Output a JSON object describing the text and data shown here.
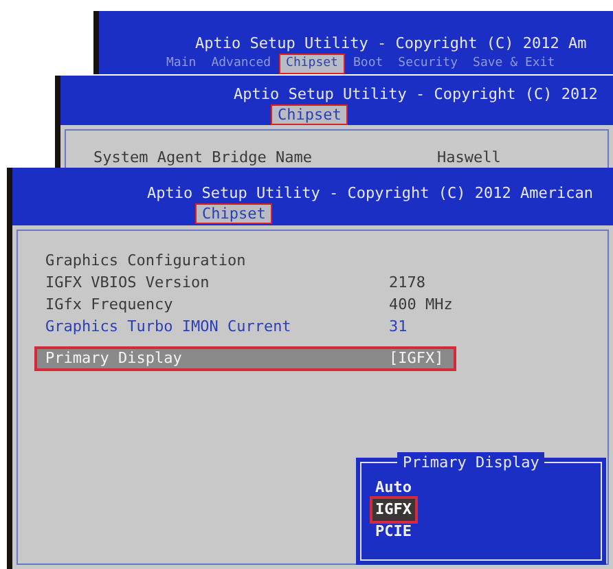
{
  "screens": [
    {
      "title": "Aptio Setup Utility - Copyright (C) 2012 Am",
      "tabs": [
        {
          "label": "Main",
          "selected": false
        },
        {
          "label": "Advanced",
          "selected": false
        },
        {
          "label": "Chipset",
          "selected": true
        },
        {
          "label": "Boot",
          "selected": false
        },
        {
          "label": "Security",
          "selected": false
        },
        {
          "label": "Save & Exit",
          "selected": false
        }
      ]
    },
    {
      "title": "Aptio Setup Utility - Copyright (C) 2012",
      "tabs": [
        {
          "label": "Chipset",
          "selected": true
        }
      ],
      "items": [
        {
          "label": "System Agent Bridge Name",
          "value": "Haswell",
          "kind": "info",
          "selected": false
        }
      ]
    },
    {
      "title": "Aptio Setup Utility - Copyright (C) 2012 American",
      "tabs": [
        {
          "label": "Chipset",
          "selected": true
        }
      ],
      "items": [
        {
          "label": "Graphics Configuration",
          "kind": "heading",
          "selected": false
        },
        {
          "label": "IGFX VBIOS Version",
          "value": "2178",
          "kind": "info",
          "selected": false
        },
        {
          "label": "IGfx Frequency",
          "value": "400 MHz",
          "kind": "info",
          "selected": false
        },
        {
          "label": "Graphics Turbo IMON Current",
          "value": "31",
          "kind": "option",
          "selected": false
        },
        {
          "label": "Primary Display",
          "value": "[IGFX]",
          "kind": "option",
          "selected": true
        }
      ],
      "popup": {
        "title": "Primary Display",
        "options": [
          {
            "label": "Auto",
            "selected": false
          },
          {
            "label": "IGFX",
            "selected": true
          },
          {
            "label": "PCIE",
            "selected": false
          }
        ]
      }
    }
  ]
}
